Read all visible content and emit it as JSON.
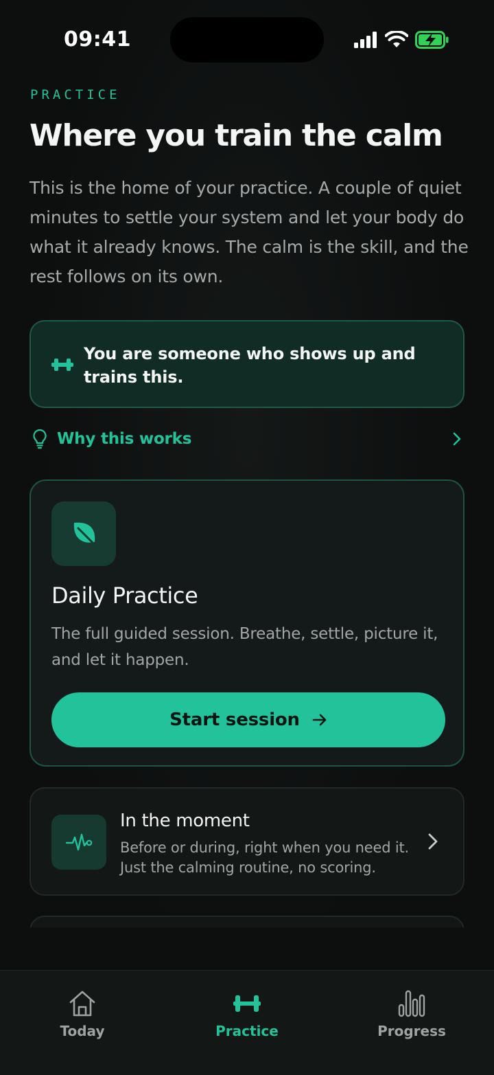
{
  "status_bar": {
    "time": "09:41"
  },
  "header": {
    "eyebrow": "PRACTICE",
    "title": "Where you train the calm",
    "intro": "This is the home of your practice. A couple of quiet minutes to settle your system and let your body do what it already knows. The calm is the skill, and the rest follows on its own."
  },
  "identity_card": {
    "text": "You are someone who shows up and trains this.",
    "icon": "dumbbell-icon"
  },
  "why_link": {
    "label": "Why this works",
    "icon": "lightbulb-icon"
  },
  "daily_practice": {
    "icon": "leaf-icon",
    "title": "Daily Practice",
    "description": "The full guided session. Breathe, settle, picture it, and let it happen.",
    "button_label": "Start session"
  },
  "in_the_moment": {
    "icon": "pulse-icon",
    "title": "In the moment",
    "description": "Before or during, right when you need it. Just the calming routine, no scoring."
  },
  "tab_bar": {
    "tabs": [
      {
        "label": "Today",
        "icon": "home-icon",
        "active": false
      },
      {
        "label": "Practice",
        "icon": "dumbbell-icon",
        "active": true
      },
      {
        "label": "Progress",
        "icon": "bar-chart-icon",
        "active": false
      }
    ]
  },
  "colors": {
    "accent": "#22c39a",
    "background": "#0d0f0f",
    "card_dark_green": "#102c25",
    "text_muted": "#a6abaa"
  }
}
